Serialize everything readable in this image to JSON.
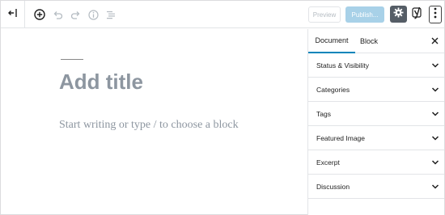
{
  "toolbar": {
    "preview_label": "Preview",
    "publish_label": "Publish..."
  },
  "editor": {
    "title_placeholder": "Add title",
    "block_placeholder": "Start writing or type / to choose a block"
  },
  "sidebar": {
    "tabs": [
      {
        "label": "Document",
        "active": true
      },
      {
        "label": "Block",
        "active": false
      }
    ],
    "panels": [
      {
        "label": "Status & Visibility"
      },
      {
        "label": "Categories"
      },
      {
        "label": "Tags"
      },
      {
        "label": "Featured Image"
      },
      {
        "label": "Excerpt"
      },
      {
        "label": "Discussion"
      }
    ]
  },
  "colors": {
    "accent": "#0085ba",
    "publish_disabled": "#a8d1e8",
    "settings_active": "#555d66",
    "placeholder_text": "#8d96a0"
  },
  "icons": [
    "back-icon",
    "add-block-icon",
    "undo-icon",
    "redo-icon",
    "info-icon",
    "outline-icon",
    "gear-icon",
    "yoast-icon",
    "more-options-icon",
    "close-icon",
    "chevron-down-icon"
  ]
}
